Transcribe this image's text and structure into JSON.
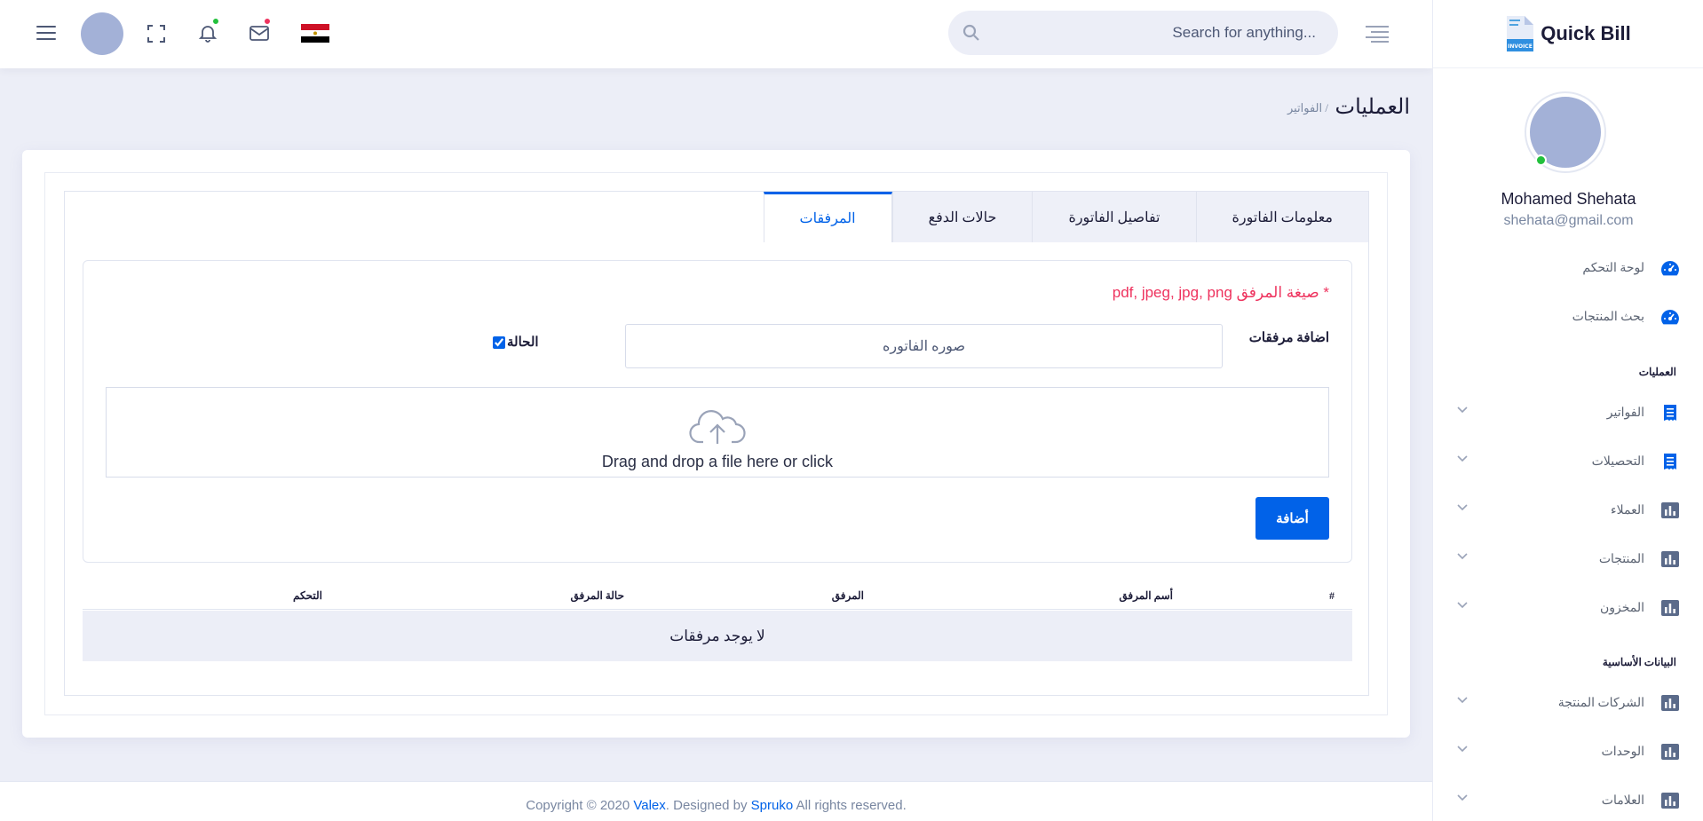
{
  "app": {
    "brand": "Quick Bill",
    "brand_logo_text": "INVOICE"
  },
  "header": {
    "search_placeholder": "Search for anything...",
    "notification_dot_color": "#22c03c",
    "mail_dot_color": "#ee335e",
    "flag": "egypt-flag"
  },
  "user": {
    "name": "Mohamed Shehata",
    "email": "shehata@gmail.com"
  },
  "sidebar": {
    "items_top": [
      {
        "label": "لوحة التحكم",
        "icon": "dashboard-icon"
      },
      {
        "label": "بحث المنتجات",
        "icon": "dashboard-icon"
      }
    ],
    "section_operations": "العمليات",
    "operations": [
      {
        "label": "الفواتير",
        "icon": "receipt-icon"
      },
      {
        "label": "التحصيلات",
        "icon": "receipt-icon"
      },
      {
        "label": "العملاء",
        "icon": "chart-icon"
      },
      {
        "label": "المنتجات",
        "icon": "chart-icon"
      },
      {
        "label": "المخزون",
        "icon": "chart-icon"
      }
    ],
    "section_basic": "البيانات الأساسية",
    "basic": [
      {
        "label": "الشركات المنتجة",
        "icon": "chart-icon"
      },
      {
        "label": "الوحدات",
        "icon": "chart-icon"
      },
      {
        "label": "العلامات",
        "icon": "chart-icon"
      }
    ]
  },
  "page": {
    "title": "العمليات",
    "breadcrumb": "/ الفواتير"
  },
  "tabs": [
    {
      "label": "معلومات الفاتورة",
      "active": false
    },
    {
      "label": "تفاصيل الفاتورة",
      "active": false
    },
    {
      "label": "حالات الدفع",
      "active": false
    },
    {
      "label": "المرفقات",
      "active": true
    }
  ],
  "attachments": {
    "format_note": "* صيغة المرفق pdf, jpeg, jpg, png",
    "add_label": "اضافة مرفقات",
    "file_name_value": "صوره الفاتوره",
    "status_label": "الحالة",
    "status_checked": true,
    "dropzone_text": "Drag and drop a file here or click",
    "add_button": "أضافة",
    "table_headers": [
      "#",
      "أسم المرفق",
      "المرفق",
      "حالة المرفق",
      "التحكم"
    ],
    "empty_message": "لا يوجد مرفقات"
  },
  "footer": {
    "prefix": "Copyright © 2020 ",
    "brand_link": "Valex",
    "middle": ". Designed by ",
    "designer_link": "Spruko",
    "suffix": " All rights reserved."
  },
  "colors": {
    "primary": "#0162e8",
    "danger": "#ee335e",
    "online": "#22c03c",
    "background": "#eceef7"
  }
}
